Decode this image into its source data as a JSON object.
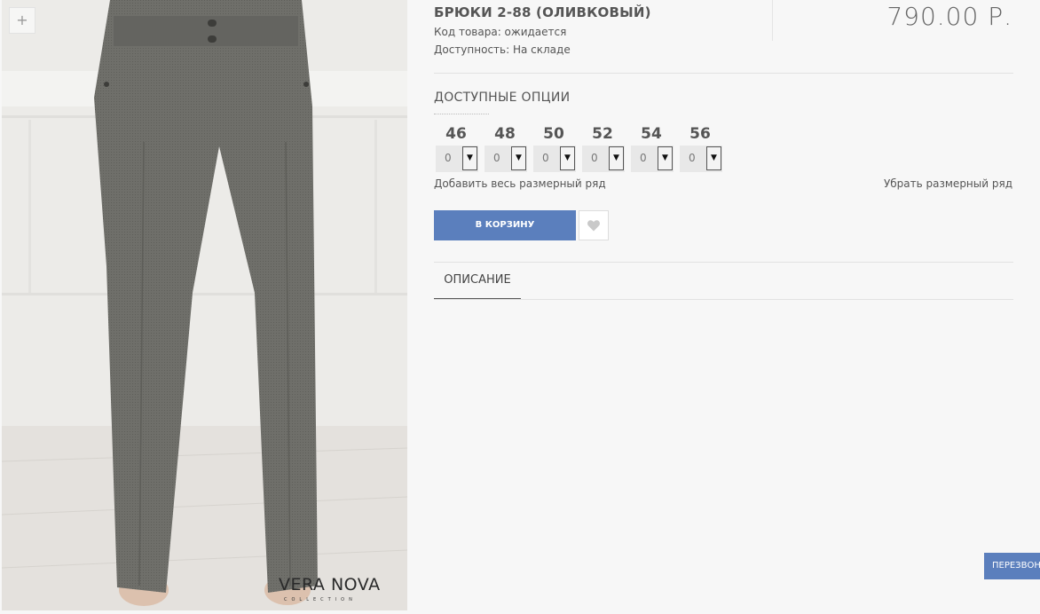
{
  "product": {
    "title": "БРЮКИ 2-88 (ОЛИВКОВЫЙ)",
    "code_line": "Код товара: ожидается",
    "availability_line": "Доступность: На складе",
    "price": "790.00 Р.",
    "image_zoom_label": "+",
    "brand_logo_text": "VERA NOVA",
    "brand_logo_subtext": "COLLECTION"
  },
  "options": {
    "title": "ДОСТУПНЫЕ ОПЦИИ",
    "sizes": [
      {
        "label": "46",
        "quantity": "0"
      },
      {
        "label": "48",
        "quantity": "0"
      },
      {
        "label": "50",
        "quantity": "0"
      },
      {
        "label": "52",
        "quantity": "0"
      },
      {
        "label": "54",
        "quantity": "0"
      },
      {
        "label": "56",
        "quantity": "0"
      }
    ],
    "add_all_label": "Добавить весь размерный ряд",
    "remove_all_label": "Убрать размерный ряд"
  },
  "actions": {
    "cart_label": "В КОРЗИНУ"
  },
  "tabs": {
    "description_label": "ОПИСАНИЕ"
  },
  "callback": {
    "label": "ПЕРЕЗВОНИТЕ"
  },
  "colors": {
    "accent": "#5b7fbd",
    "fabric": "#6b6b66",
    "background": "#f7f7f7"
  }
}
